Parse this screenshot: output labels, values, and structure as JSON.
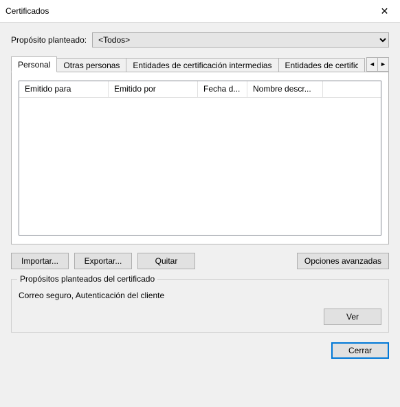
{
  "window": {
    "title": "Certificados",
    "close_icon": "✕"
  },
  "purpose": {
    "label": "Propósito planteado:",
    "selected": "<Todos>"
  },
  "tabs": {
    "items": [
      {
        "label": "Personal"
      },
      {
        "label": "Otras personas"
      },
      {
        "label": "Entidades de certificación intermedias"
      },
      {
        "label": "Entidades de certificac"
      }
    ],
    "scroll_left": "◄",
    "scroll_right": "►"
  },
  "listview": {
    "columns": {
      "issued_to": "Emitido para",
      "issued_by": "Emitido por",
      "exp_date": "Fecha d...",
      "friendly_name": "Nombre descr..."
    }
  },
  "buttons": {
    "import": "Importar...",
    "export": "Exportar...",
    "remove": "Quitar",
    "advanced": "Opciones avanzadas",
    "view": "Ver",
    "close": "Cerrar"
  },
  "groupbox": {
    "legend": "Propósitos planteados del certificado",
    "purposes_text": "Correo seguro, Autenticación del cliente"
  }
}
